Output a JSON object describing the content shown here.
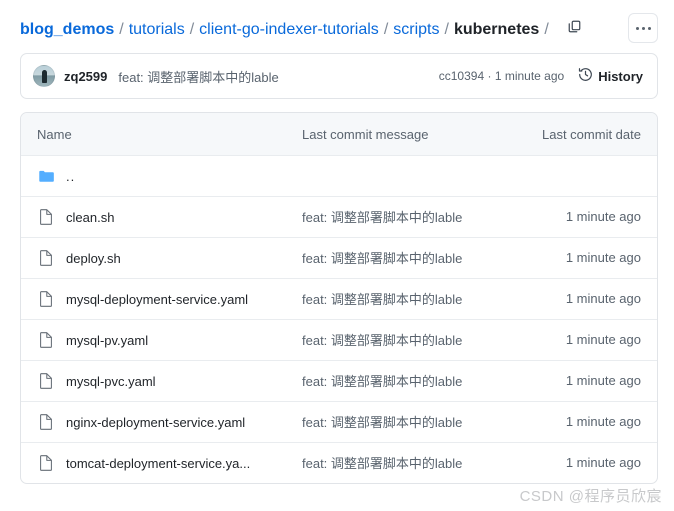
{
  "breadcrumb": {
    "segments": [
      {
        "label": "blog_demos",
        "current": false,
        "root": true
      },
      {
        "label": "tutorials",
        "current": false,
        "root": false
      },
      {
        "label": "client-go-indexer-tutorials",
        "current": false,
        "root": false
      },
      {
        "label": "scripts",
        "current": false,
        "root": false
      },
      {
        "label": "kubernetes",
        "current": true,
        "root": false
      }
    ],
    "separator": "/",
    "trailing_separator": "/",
    "copy_icon": "copy-path-icon",
    "more_icon": "kebab-more-icon"
  },
  "commit_bar": {
    "avatar_alt": "zq2599",
    "author": "zq2599",
    "message": "feat: 调整部署脚本中的lable",
    "sha": "cc10394",
    "meta_separator": "·",
    "relative_time": "1 minute ago",
    "history_label": "History",
    "history_icon": "history-clock-icon"
  },
  "file_table": {
    "columns": {
      "name": "Name",
      "message": "Last commit message",
      "date": "Last commit date"
    },
    "rows": [
      {
        "name": "..",
        "type": "directory",
        "icon": "folder-icon",
        "message": "",
        "date": ""
      },
      {
        "name": "clean.sh",
        "type": "file",
        "icon": "file-icon",
        "message": "feat: 调整部署脚本中的lable",
        "date": "1 minute ago"
      },
      {
        "name": "deploy.sh",
        "type": "file",
        "icon": "file-icon",
        "message": "feat: 调整部署脚本中的lable",
        "date": "1 minute ago"
      },
      {
        "name": "mysql-deployment-service.yaml",
        "type": "file",
        "icon": "file-icon",
        "message": "feat: 调整部署脚本中的lable",
        "date": "1 minute ago"
      },
      {
        "name": "mysql-pv.yaml",
        "type": "file",
        "icon": "file-icon",
        "message": "feat: 调整部署脚本中的lable",
        "date": "1 minute ago"
      },
      {
        "name": "mysql-pvc.yaml",
        "type": "file",
        "icon": "file-icon",
        "message": "feat: 调整部署脚本中的lable",
        "date": "1 minute ago"
      },
      {
        "name": "nginx-deployment-service.yaml",
        "type": "file",
        "icon": "file-icon",
        "message": "feat: 调整部署脚本中的lable",
        "date": "1 minute ago"
      },
      {
        "name": "tomcat-deployment-service.ya...",
        "type": "file",
        "icon": "file-icon",
        "message": "feat: 调整部署脚本中的lable",
        "date": "1 minute ago"
      }
    ]
  },
  "watermark": {
    "text": "CSDN @程序员欣宸"
  },
  "colors": {
    "link": "#0969da",
    "text": "#1f2328",
    "muted": "#59636e",
    "border": "#e1e4e8",
    "header_bg": "#f6f8fa",
    "folder": "#54aeff"
  }
}
